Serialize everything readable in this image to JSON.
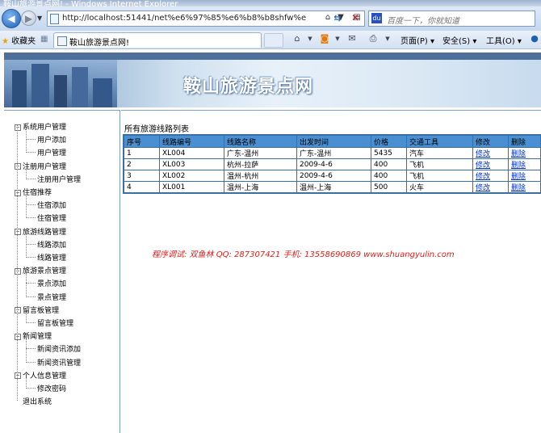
{
  "window": {
    "title": "鞍山旅游景点网! - Windows Internet Explorer"
  },
  "addressbar": {
    "url": "http://localhost:51441/net%e6%97%85%e6%b8%b8shfw%e"
  },
  "search": {
    "placeholder": "百度一下，你就知道"
  },
  "tabs": {
    "favorites_label": "收藏夹",
    "active_tab": "鞍山旅游景点网!"
  },
  "commandbar": {
    "page_label": "页面(P)",
    "safety_label": "安全(S)",
    "tools_label": "工具(O)"
  },
  "banner": {
    "title": "鞍山旅游景点网"
  },
  "sidebar": {
    "groups": [
      {
        "label": "系统用户管理",
        "items": [
          "用户添加",
          "用户管理"
        ]
      },
      {
        "label": "注册用户管理",
        "items": [
          "注册用户管理"
        ]
      },
      {
        "label": "住宿推荐",
        "items": [
          "住宿添加",
          "住宿管理"
        ]
      },
      {
        "label": "旅游线路管理",
        "items": [
          "线路添加",
          "线路管理"
        ]
      },
      {
        "label": "旅游景点管理",
        "items": [
          "景点添加",
          "景点管理"
        ]
      },
      {
        "label": "留言板管理",
        "items": [
          "留言板管理"
        ]
      },
      {
        "label": "新闻管理",
        "items": [
          "新闻资讯添加",
          "新闻资讯管理"
        ]
      },
      {
        "label": "个人信息管理",
        "items": [
          "修改密码"
        ]
      }
    ],
    "logout": "退出系统"
  },
  "main": {
    "list_title": "所有旅游线路列表",
    "columns": [
      "序号",
      "线路编号",
      "线路名称",
      "出发时间",
      "价格",
      "交通工具",
      "修改",
      "删除"
    ],
    "rows": [
      [
        "1",
        "XL004",
        "广东-温州",
        "广东-温州",
        "5435",
        "汽车",
        "修改",
        "删除"
      ],
      [
        "2",
        "XL003",
        "杭州-拉萨",
        "2009-4-6",
        "400",
        "飞机",
        "修改",
        "删除"
      ],
      [
        "3",
        "XL002",
        "温州-杭州",
        "2009-4-6",
        "400",
        "飞机",
        "修改",
        "删除"
      ],
      [
        "4",
        "XL001",
        "温州-上海",
        "温州-上海",
        "500",
        "火车",
        "修改",
        "删除"
      ]
    ],
    "credit": "程序调试: 双鱼林   QQ: 287307421   手机: 13558690869   www.shuangyulin.com"
  }
}
